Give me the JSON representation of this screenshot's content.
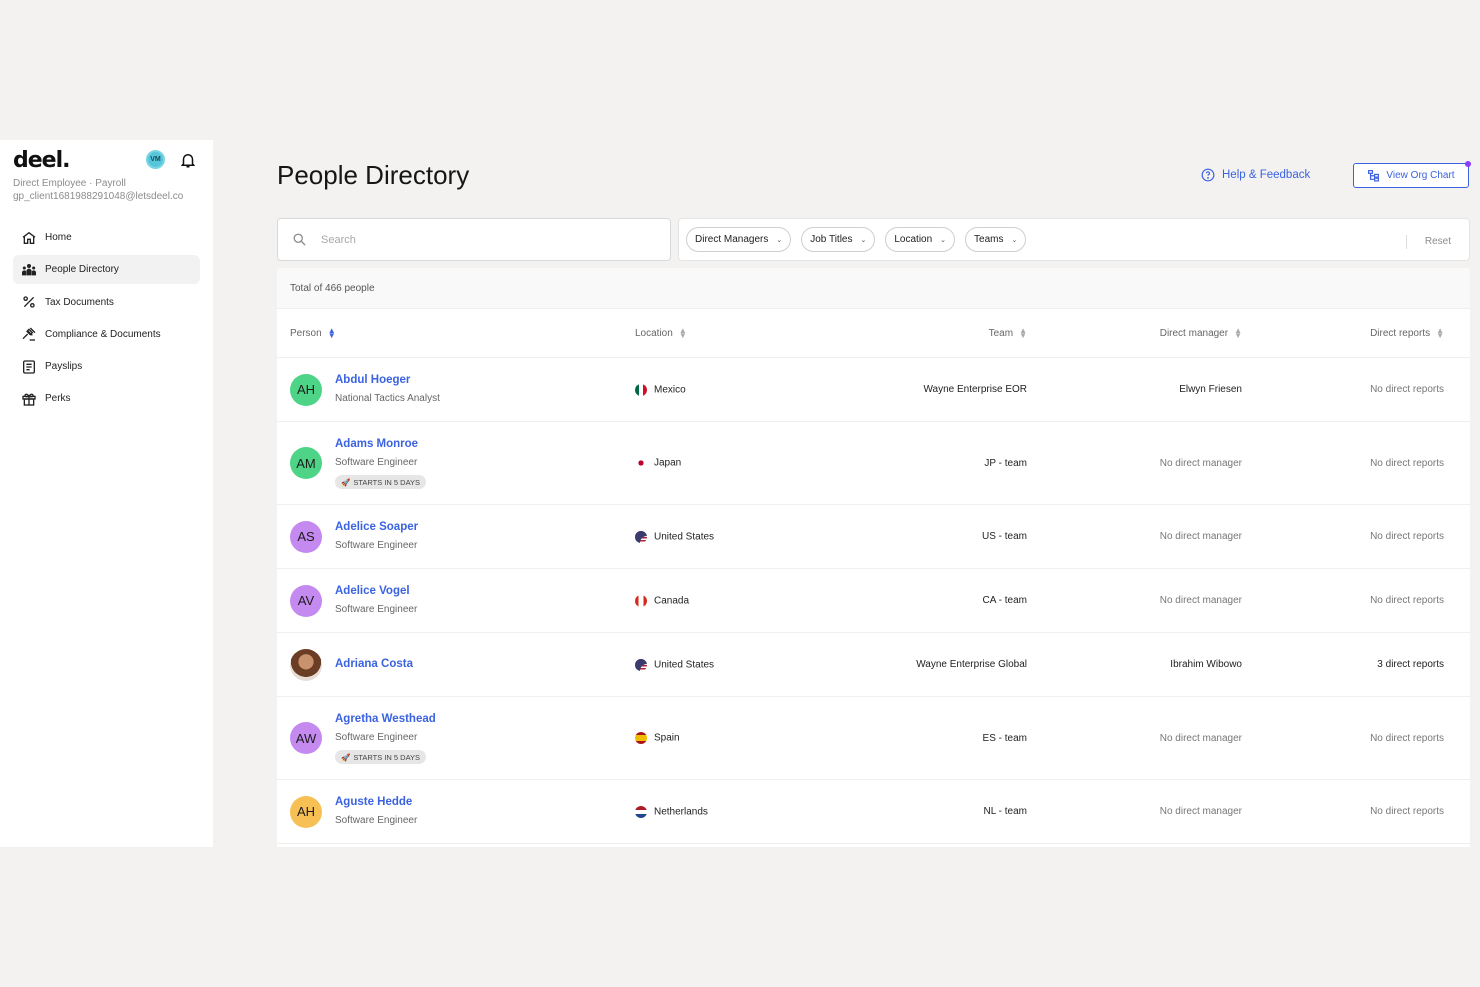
{
  "brand": {
    "logo": "deel."
  },
  "account": {
    "initials": "VM",
    "type": "Direct Employee · Payroll",
    "email": "gp_client1681988291048@letsdeel.co"
  },
  "nav": [
    {
      "label": "Home",
      "icon": "home-icon"
    },
    {
      "label": "People Directory",
      "icon": "people-icon",
      "active": true
    },
    {
      "label": "Tax Documents",
      "icon": "percent-icon"
    },
    {
      "label": "Compliance & Documents",
      "icon": "gavel-icon"
    },
    {
      "label": "Payslips",
      "icon": "payslip-icon"
    },
    {
      "label": "Perks",
      "icon": "gift-icon"
    }
  ],
  "page": {
    "title": "People Directory",
    "help": "Help & Feedback",
    "org_chart": "View Org Chart"
  },
  "search": {
    "placeholder": "Search"
  },
  "filters": {
    "chips": [
      "Direct Managers",
      "Job Titles",
      "Location",
      "Teams"
    ],
    "reset": "Reset"
  },
  "table": {
    "total": "Total of 466 people",
    "headers": {
      "person": "Person",
      "location": "Location",
      "team": "Team",
      "manager": "Direct manager",
      "reports": "Direct reports"
    },
    "rows": [
      {
        "initials": "AH",
        "avatar_color": "#4ed487",
        "name": "Abdul Hoeger",
        "title": "National Tactics Analyst",
        "badge": "",
        "flag": "mx",
        "location": "Mexico",
        "team": "Wayne Enterprise EOR",
        "manager": "Elwyn Friesen",
        "reports": "No direct reports"
      },
      {
        "initials": "AM",
        "avatar_color": "#4ed487",
        "name": "Adams Monroe",
        "title": "Software Engineer",
        "badge": "STARTS IN 5 DAYS",
        "flag": "jp",
        "location": "Japan",
        "team": "JP - team",
        "manager": "No direct manager",
        "reports": "No direct reports"
      },
      {
        "initials": "AS",
        "avatar_color": "#c58af0",
        "name": "Adelice Soaper",
        "title": "Software Engineer",
        "badge": "",
        "flag": "us",
        "location": "United States",
        "team": "US - team",
        "manager": "No direct manager",
        "reports": "No direct reports"
      },
      {
        "initials": "AV",
        "avatar_color": "#c58af0",
        "name": "Adelice Vogel",
        "title": "Software Engineer",
        "badge": "",
        "flag": "ca",
        "location": "Canada",
        "team": "CA - team",
        "manager": "No direct manager",
        "reports": "No direct reports"
      },
      {
        "initials": "",
        "avatar_color": "photo",
        "name": "Adriana Costa",
        "title": "",
        "badge": "",
        "flag": "us",
        "location": "United States",
        "team": "Wayne Enterprise Global",
        "manager": "Ibrahim Wibowo",
        "reports": "3 direct reports"
      },
      {
        "initials": "AW",
        "avatar_color": "#c58af0",
        "name": "Agretha Westhead",
        "title": "Software Engineer",
        "badge": "STARTS IN 5 DAYS",
        "flag": "es",
        "location": "Spain",
        "team": "ES - team",
        "manager": "No direct manager",
        "reports": "No direct reports"
      },
      {
        "initials": "AH",
        "avatar_color": "#f7c055",
        "name": "Aguste Hedde",
        "title": "Software Engineer",
        "badge": "",
        "flag": "nl",
        "location": "Netherlands",
        "team": "NL - team",
        "manager": "No direct manager",
        "reports": "No direct reports"
      }
    ]
  },
  "colors": {
    "accent": "#3b62e0",
    "notification_dot": "#8b3dff"
  }
}
